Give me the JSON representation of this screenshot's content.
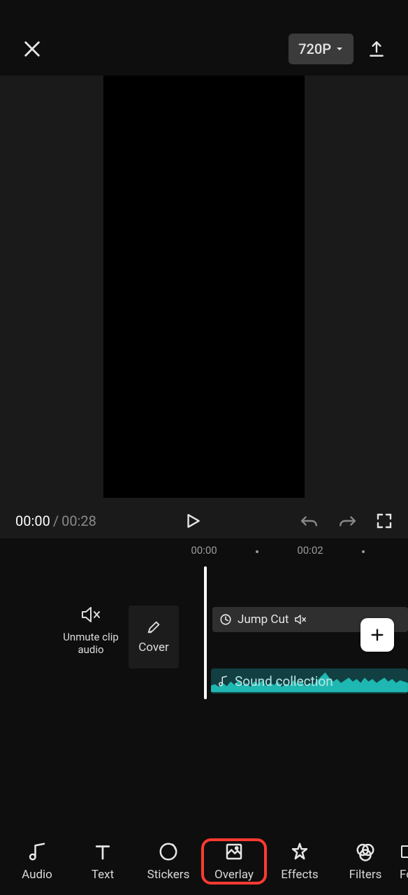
{
  "resolution": "720P",
  "time": {
    "current": "00:00",
    "duration": "00:28"
  },
  "ruler": {
    "start": "00:00",
    "mid": "00:02"
  },
  "mute_label_line1": "Unmute clip",
  "mute_label_line2": "audio",
  "cover_label": "Cover",
  "clip": {
    "effect": "Jump Cut"
  },
  "audio": {
    "label": "Sound collection"
  },
  "tools": {
    "audio": "Audio",
    "text": "Text",
    "stickers": "Stickers",
    "overlay": "Overlay",
    "effects": "Effects",
    "filters": "Filters",
    "format": "Fo"
  }
}
